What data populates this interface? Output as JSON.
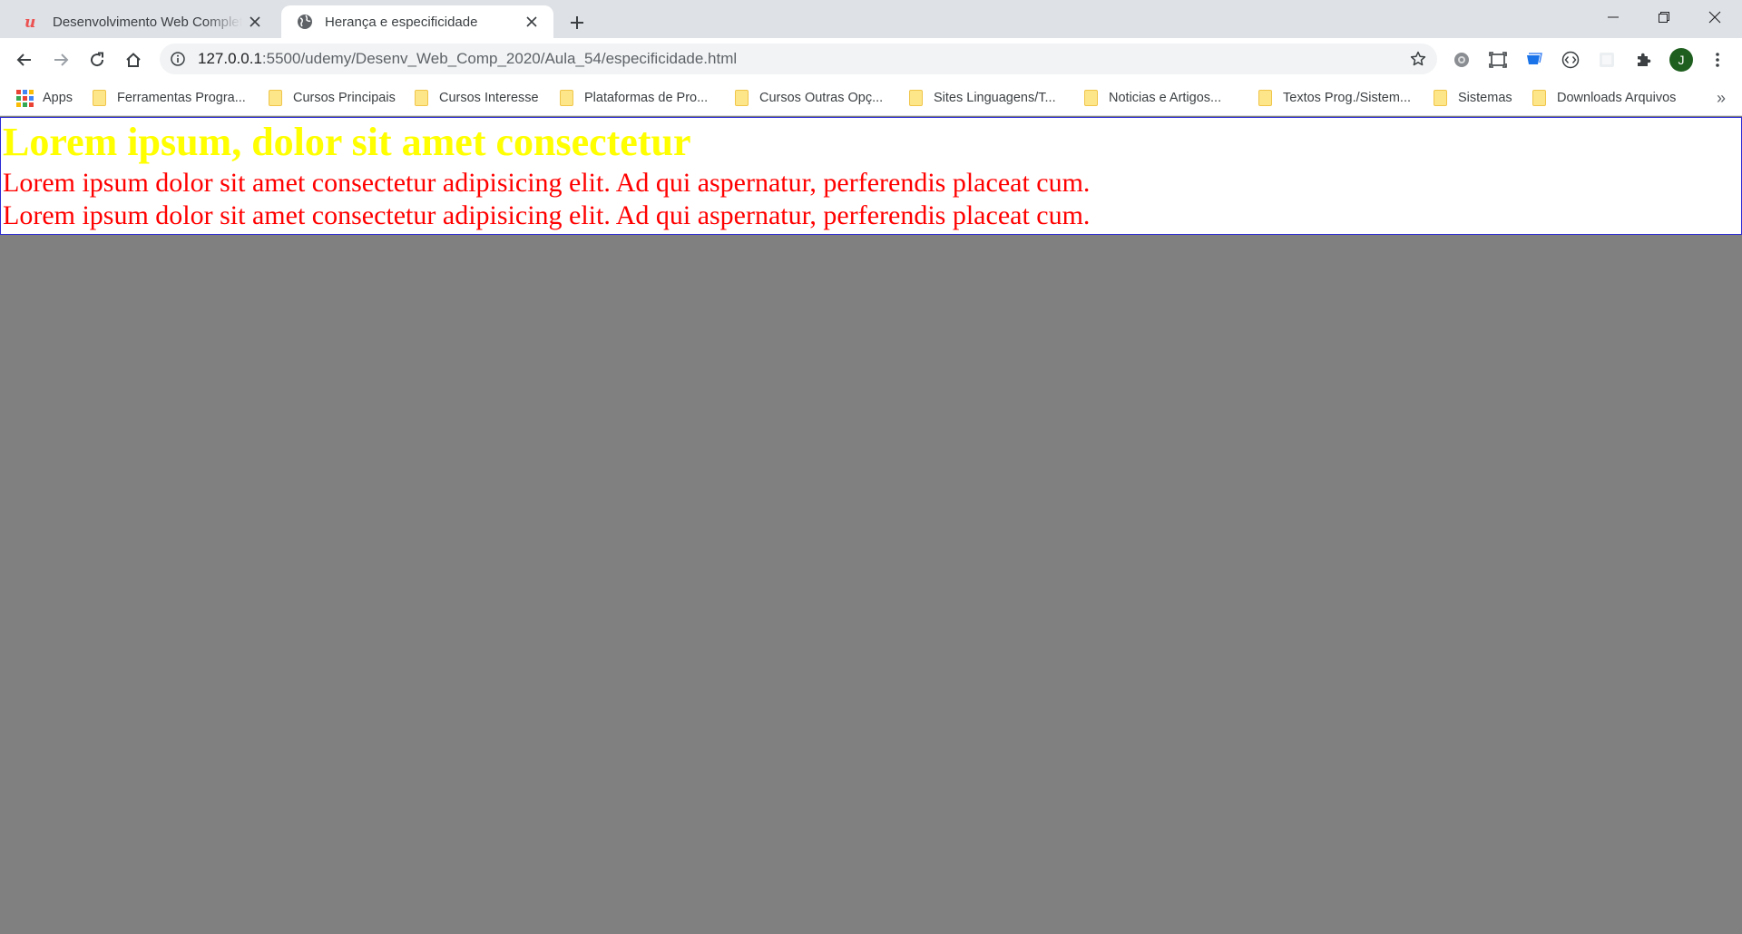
{
  "browser": {
    "tabs": [
      {
        "title": "Desenvolvimento Web Completo",
        "icon": "udemy-icon",
        "active": false
      },
      {
        "title": "Herança e especificidade",
        "icon": "globe-icon",
        "active": true
      }
    ],
    "url_host": "127.0.0.1",
    "url_path": ":5500/udemy/Desenv_Web_Comp_2020/Aula_54/especificidade.html",
    "profile_initial": "J",
    "bookmarks": [
      "Apps",
      "Ferramentas Progra...",
      "Cursos Principais",
      "Cursos Interesse",
      "Plataformas de Pro...",
      "Cursos Outras Opç...",
      "Sites Linguagens/T...",
      "Noticias e Artigos...",
      "Textos Prog./Sistem...",
      "Sistemas",
      "Downloads Arquivos"
    ],
    "bookmarks_more": "»"
  },
  "page": {
    "heading": "Lorem ipsum, dolor sit amet consectetur",
    "paragraphs": [
      "Lorem ipsum dolor sit amet consectetur adipisicing elit. Ad qui aspernatur, perferendis placeat cum.",
      "Lorem ipsum dolor sit amet consectetur adipisicing elit. Ad qui aspernatur, perferendis placeat cum."
    ]
  },
  "colors": {
    "page_background": "#808080",
    "heading": "#ffff00",
    "paragraph": "#ff0000",
    "content_border": "#2b2bd6"
  }
}
